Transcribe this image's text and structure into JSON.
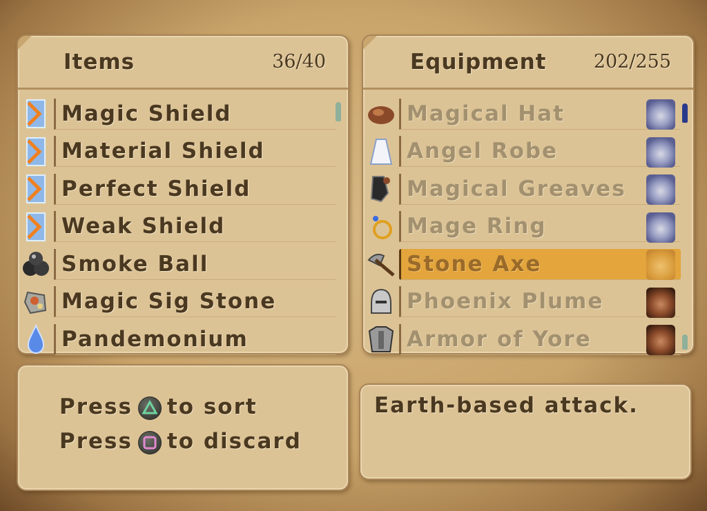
{
  "items_panel": {
    "title": "Items",
    "count": "36/40",
    "rows": [
      {
        "label": "Magic Shield",
        "icon": "shield-icon"
      },
      {
        "label": "Material Shield",
        "icon": "shield-icon"
      },
      {
        "label": "Perfect Shield",
        "icon": "shield-icon"
      },
      {
        "label": "Weak Shield",
        "icon": "shield-icon"
      },
      {
        "label": "Smoke Ball",
        "icon": "smoke-ball-icon"
      },
      {
        "label": "Magic Sig Stone",
        "icon": "stone-icon"
      },
      {
        "label": "Pandemonium",
        "icon": "potion-icon"
      }
    ]
  },
  "equipment_panel": {
    "title": "Equipment",
    "count": "202/255",
    "rows": [
      {
        "label": "Magical Hat",
        "icon": "hat-icon",
        "portrait": "mage-portrait"
      },
      {
        "label": "Angel Robe",
        "icon": "robe-icon",
        "portrait": "mage-portrait"
      },
      {
        "label": "Magical Greaves",
        "icon": "greaves-icon",
        "portrait": "mage-portrait"
      },
      {
        "label": "Mage Ring",
        "icon": "ring-icon",
        "portrait": "mage-portrait"
      },
      {
        "label": "Stone Axe",
        "icon": "axe-icon",
        "portrait": "warrior-portrait",
        "selected": true
      },
      {
        "label": "Phoenix Plume",
        "icon": "helmet-icon",
        "portrait": "warrior-portrait"
      },
      {
        "label": "Armor of Yore",
        "icon": "armor-icon",
        "portrait": "warrior-portrait"
      }
    ]
  },
  "help": {
    "line1_prefix": "Press",
    "line1_suffix": "to sort",
    "line1_button": "triangle-button-icon",
    "line2_prefix": "Press",
    "line2_suffix": "to discard",
    "line2_button": "square-button-icon"
  },
  "description": {
    "text": "Earth-based attack."
  },
  "colors": {
    "selection": "#e3a53c",
    "text": "#4a3820",
    "dim_text": "#a2906f",
    "panel": "#dcc396",
    "triangle": "#6fd3a0",
    "square": "#e08ad0"
  }
}
